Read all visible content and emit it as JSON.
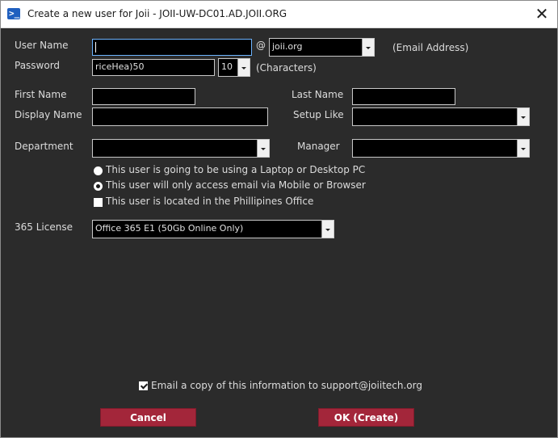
{
  "window": {
    "title": "Create a new user for Joii - JOII-UW-DC01.AD.JOII.ORG",
    "close_label": "✕"
  },
  "form": {
    "username_label": "User Name",
    "username_value": "",
    "at_sign": "@",
    "domain_value": "joii.org",
    "email_hint": "(Email Address)",
    "password_label": "Password",
    "password_value": "riceHea)50",
    "password_length": "10",
    "characters_hint": "(Characters)",
    "firstname_label": "First Name",
    "firstname_value": "",
    "lastname_label": "Last Name",
    "lastname_value": "",
    "displayname_label": "Display Name",
    "displayname_value": "",
    "setuplike_label": "Setup Like",
    "setuplike_value": "",
    "department_label": "Department",
    "department_value": "",
    "manager_label": "Manager",
    "manager_value": "",
    "options": [
      {
        "label": "This user is going to be using a Laptop or Desktop PC",
        "type": "radio",
        "selected": false
      },
      {
        "label": "This user will only access email via Mobile or Browser",
        "type": "radio",
        "selected": true
      },
      {
        "label": "This user is located in the Phillipines Office",
        "type": "checkbox",
        "checked": false
      }
    ],
    "license_label": "365 License",
    "license_value": "Office 365 E1 (50Gb Online Only)",
    "email_copy_label": "Email a copy of this information to support@joiitech.org",
    "email_copy_checked": true
  },
  "buttons": {
    "cancel": "Cancel",
    "ok": "OK (Create)"
  },
  "colors": {
    "background": "#2b2b2b",
    "button": "#a3263a",
    "focus_border": "#6db4ff"
  }
}
